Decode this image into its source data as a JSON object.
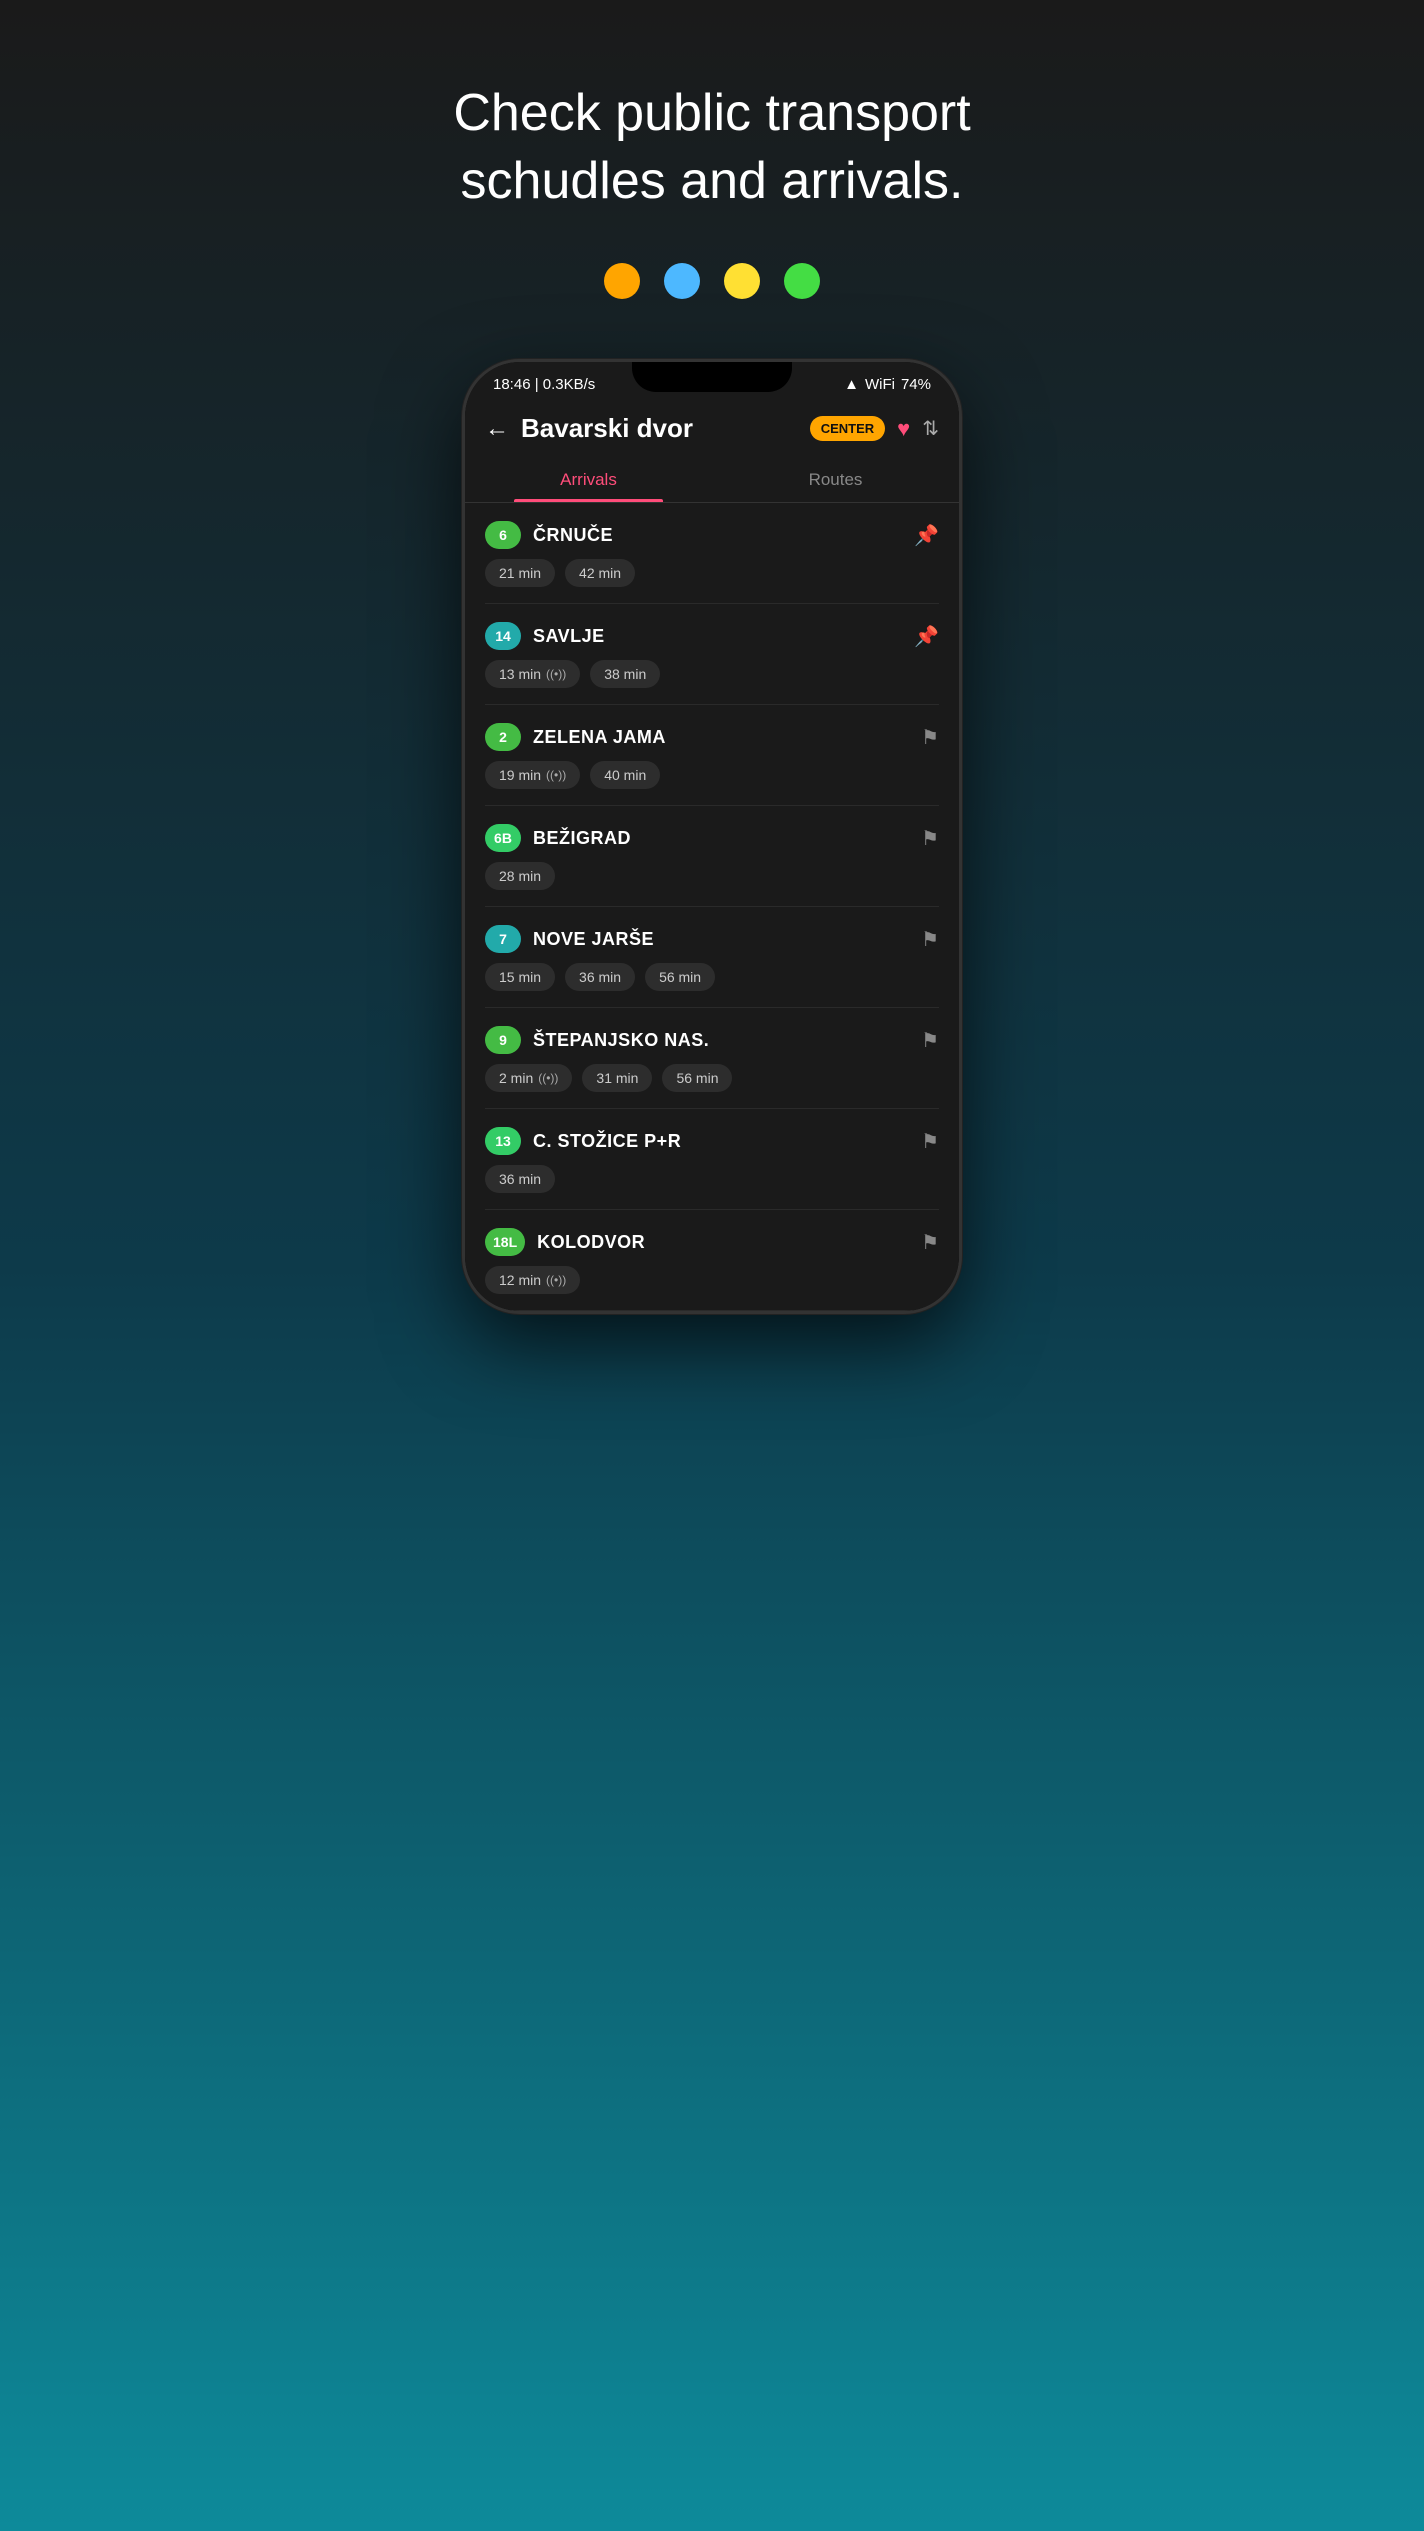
{
  "header": {
    "title": "Check public transport schudles and arrivals."
  },
  "dots": [
    {
      "color": "orange",
      "class": "dot-orange"
    },
    {
      "color": "blue",
      "class": "dot-blue"
    },
    {
      "color": "yellow",
      "class": "dot-yellow"
    },
    {
      "color": "green",
      "class": "dot-green"
    }
  ],
  "statusBar": {
    "time": "18:46 | 0.3KB/s",
    "battery": "74%"
  },
  "appHeader": {
    "back_label": "←",
    "stop_name": "Bavarski dvor",
    "center_badge": "CENTER",
    "sort_icon": "⇅"
  },
  "tabs": [
    {
      "label": "Arrivals",
      "active": true
    },
    {
      "label": "Routes",
      "active": false
    }
  ],
  "routes": [
    {
      "line": "6",
      "line_class": "line-green",
      "name": "ČRNUČE",
      "times": [
        {
          "text": "21 min",
          "live": false
        },
        {
          "text": "42 min",
          "live": false
        }
      ],
      "pinned": true
    },
    {
      "line": "14",
      "line_class": "line-teal",
      "name": "SAVLJE",
      "times": [
        {
          "text": "13 min",
          "live": true
        },
        {
          "text": "38 min",
          "live": false
        }
      ],
      "pinned": true
    },
    {
      "line": "2",
      "line_class": "line-green",
      "name": "ZELENA JAMA",
      "times": [
        {
          "text": "19 min",
          "live": true
        },
        {
          "text": "40 min",
          "live": false
        }
      ],
      "pinned": false
    },
    {
      "line": "6B",
      "line_class": "line-green2",
      "name": "BEŽIGRAD",
      "times": [
        {
          "text": "28 min",
          "live": false
        }
      ],
      "pinned": false
    },
    {
      "line": "7",
      "line_class": "line-teal",
      "name": "NOVE JARŠE",
      "times": [
        {
          "text": "15 min",
          "live": false
        },
        {
          "text": "36 min",
          "live": false
        },
        {
          "text": "56 min",
          "live": false
        }
      ],
      "pinned": false
    },
    {
      "line": "9",
      "line_class": "line-green",
      "name": "ŠTEPANJSKO NAS.",
      "times": [
        {
          "text": "2 min",
          "live": true
        },
        {
          "text": "31 min",
          "live": false
        },
        {
          "text": "56 min",
          "live": false
        }
      ],
      "pinned": false
    },
    {
      "line": "13",
      "line_class": "line-green2",
      "name": "C. STOŽICE P+R",
      "times": [
        {
          "text": "36 min",
          "live": false
        }
      ],
      "pinned": false
    },
    {
      "line": "18L",
      "line_class": "line-green",
      "name": "KOLODVOR",
      "times": [
        {
          "text": "12 min",
          "live": true
        }
      ],
      "pinned": false
    }
  ]
}
